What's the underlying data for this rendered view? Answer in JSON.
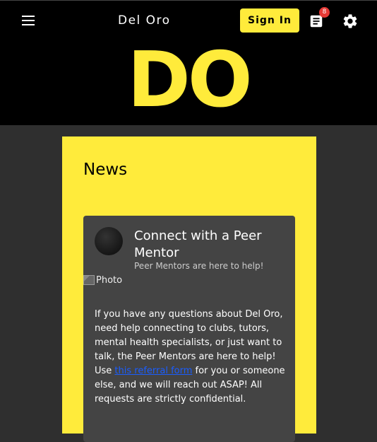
{
  "header": {
    "title": "Del Oro",
    "signin_label": "Sign In",
    "notification_count": "8"
  },
  "hero": {
    "logo_text": "DO"
  },
  "news": {
    "title": "News",
    "card": {
      "title": "Connect with a Peer Mentor",
      "subtitle": "Peer Mentors are here to help!",
      "photo_alt": "Photo",
      "body_before": "If you have any questions about Del Oro, need help connecting to clubs, tutors, mental health specialists, or just want to talk, the Peer Mentors are here to help! Use ",
      "link_text": "this referral form",
      "body_after": " for you or someone else, and we will reach out ASAP! All requests are strictly confidential."
    }
  },
  "colors": {
    "accent": "#ffeb3b",
    "header_bg": "#000000",
    "page_bg": "#2f2f2f",
    "card_bg": "#444444",
    "badge": "#e53935"
  },
  "icons": {
    "menu": "menu-icon",
    "document": "document-icon",
    "settings": "gear-icon"
  }
}
